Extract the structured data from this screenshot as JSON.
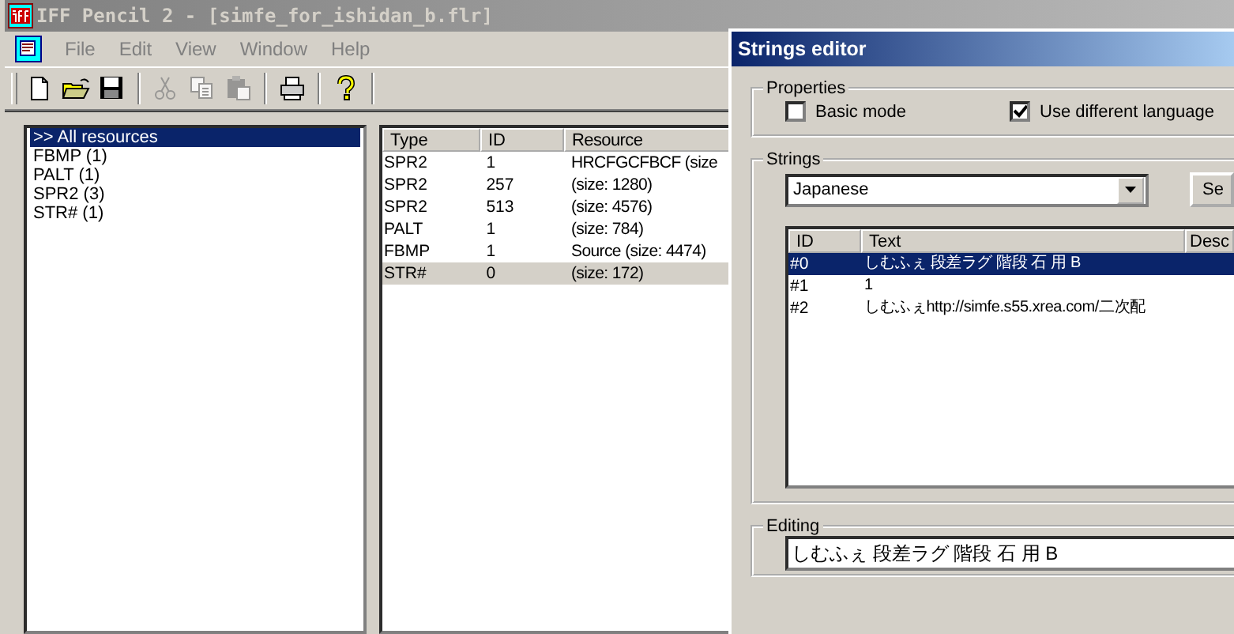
{
  "window": {
    "title": "IFF Pencil 2 - [simfe_for_ishidan_b.flr]"
  },
  "menu": [
    "File",
    "Edit",
    "View",
    "Window",
    "Help"
  ],
  "toolbar": [
    {
      "kind": "new",
      "disabled": false
    },
    {
      "kind": "open",
      "disabled": false
    },
    {
      "kind": "save",
      "disabled": false
    },
    {
      "kind": "separator"
    },
    {
      "kind": "cut",
      "disabled": true
    },
    {
      "kind": "copy",
      "disabled": true
    },
    {
      "kind": "paste",
      "disabled": true
    },
    {
      "kind": "separator"
    },
    {
      "kind": "print",
      "disabled": false
    },
    {
      "kind": "separator"
    },
    {
      "kind": "help",
      "disabled": false
    },
    {
      "kind": "separator"
    }
  ],
  "resource_tree": [
    {
      "label": ">> All resources",
      "selected": true
    },
    {
      "label": "FBMP (1)",
      "selected": false
    },
    {
      "label": "PALT (1)",
      "selected": false
    },
    {
      "label": "SPR2 (3)",
      "selected": false
    },
    {
      "label": "STR# (1)",
      "selected": false
    }
  ],
  "resource_table": {
    "columns": [
      "Type",
      "ID",
      "Resource"
    ],
    "rows": [
      {
        "cells": [
          "SPR2",
          "1",
          "HRCFGCFBCF (size"
        ],
        "selected": false
      },
      {
        "cells": [
          "SPR2",
          "257",
          " (size: 1280)"
        ],
        "selected": false
      },
      {
        "cells": [
          "SPR2",
          "513",
          " (size: 4576)"
        ],
        "selected": false
      },
      {
        "cells": [
          "PALT",
          "1",
          " (size: 784)"
        ],
        "selected": false
      },
      {
        "cells": [
          "FBMP",
          "1",
          "Source (size: 4474)"
        ],
        "selected": false
      },
      {
        "cells": [
          "STR#",
          "0",
          " (size: 172)"
        ],
        "selected": true
      }
    ]
  },
  "strings_editor": {
    "title": "Strings editor",
    "properties": {
      "title": "Properties",
      "options": [
        {
          "label": "Basic mode",
          "checked": false
        },
        {
          "label": "Use different language",
          "checked": true
        }
      ]
    },
    "strings": {
      "title": "Strings",
      "language": "Japanese",
      "button": "Se",
      "columns": [
        "ID",
        "Text",
        "Desc"
      ],
      "rows": [
        {
          "cells": [
            "#0",
            "しむふぇ 段差ラグ 階段 石 用 B"
          ],
          "selected": true
        },
        {
          "cells": [
            "#1",
            "1"
          ],
          "selected": false
        },
        {
          "cells": [
            "#2",
            "しむふぇhttp://simfe.s55.xrea.com/二次配"
          ],
          "selected": false
        }
      ]
    },
    "editing": {
      "title": "Editing",
      "value": "しむふぇ 段差ラグ 階段 石 用 B"
    }
  }
}
